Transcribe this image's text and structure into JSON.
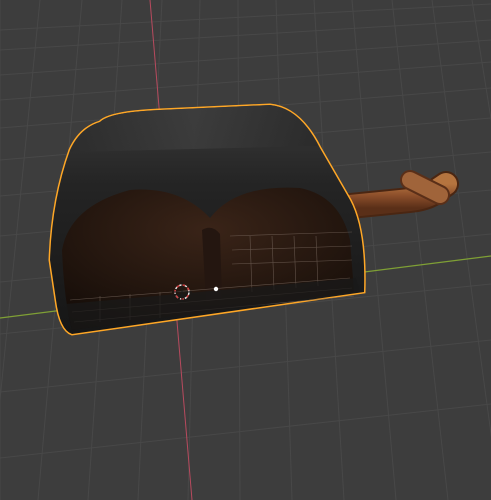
{
  "viewport": {
    "background": "#3d3d3d",
    "grid_color": "#4a4a4a",
    "x_axis_color": "#8fb03a",
    "y_axis_color": "#b84a5e",
    "selection_outline_color": "#ffa726",
    "object_body_color": "#2b2b2b",
    "object_interior_color": "#2a1a12",
    "pipe_color": "#8a4d2a",
    "icons": [
      "3d-cursor-icon",
      "object-origin-dot"
    ]
  }
}
